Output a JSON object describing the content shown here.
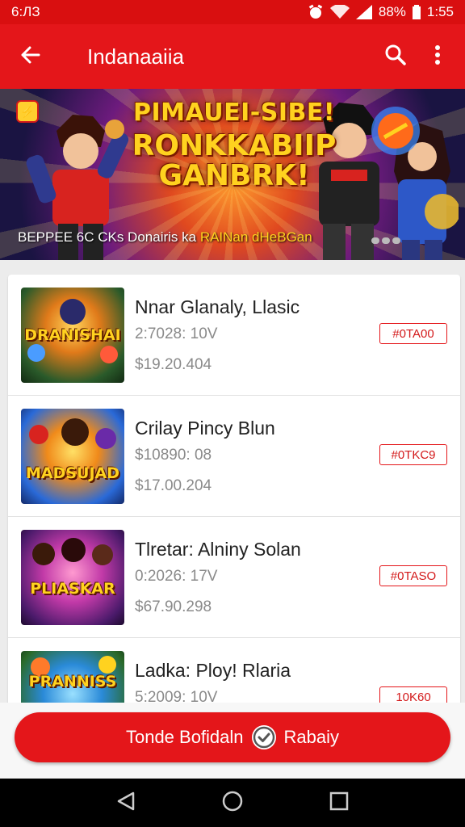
{
  "status_bar": {
    "time_left": "6:ЛЗ",
    "battery": "88%",
    "time_right": "1:55"
  },
  "app_bar": {
    "title": "Indanaaiia"
  },
  "banner": {
    "headline": [
      "PIMAUEI-SIBE!",
      "RONKKABIIP",
      "GANBRK!"
    ],
    "caption_main": "BEPPEE 6C CKs Donairis ka ",
    "caption_highlight": "RAINan dHeBGan"
  },
  "items": [
    {
      "name": "Nnar Glanaly, Llasic",
      "line2": "2:7028: 10V",
      "line3": "$19.20.404",
      "tag": "#0TA00",
      "thumb_text": "DRANISHAI"
    },
    {
      "name": "Crilay Pincy Blun",
      "line2": "$10890: 08",
      "line3": "$17.00.204",
      "tag": "#0TKC9",
      "thumb_text": "MADSUJAD"
    },
    {
      "name": "Tlretar: Alniny Solan",
      "line2": "0:2026: 17V",
      "line3": "$67.90.298",
      "tag": "#0TASO",
      "thumb_text": "PLIASKAR"
    },
    {
      "name": "Ladka: Ploy! Rlaria",
      "line2": "5:2009: 10V",
      "line3": "",
      "tag": "10K60",
      "thumb_text": "PRANNISS"
    }
  ],
  "cta": {
    "label_left": "Tonde Bofidaln",
    "label_right": "Rabaiy"
  },
  "colors": {
    "brand_red": "#e4161a",
    "status_red": "#d90f10"
  },
  "icons": [
    "alarm-icon",
    "wifi-icon",
    "signal-icon",
    "battery-icon",
    "back-arrow-icon",
    "search-icon",
    "more-vert-icon",
    "check-circle-icon",
    "nav-back-icon",
    "nav-home-icon",
    "nav-recents-icon"
  ]
}
